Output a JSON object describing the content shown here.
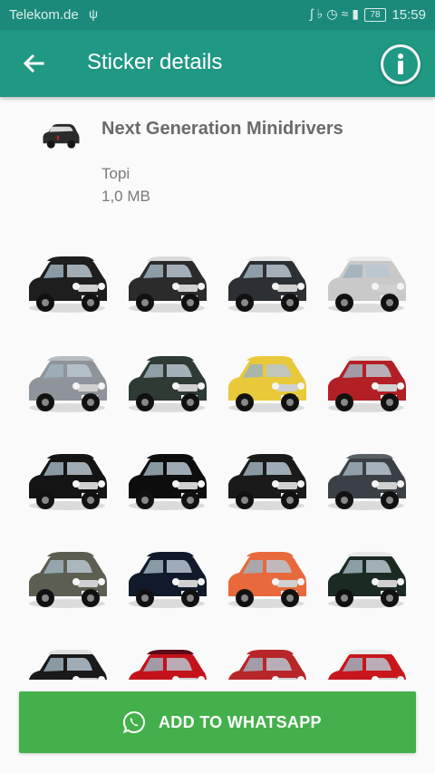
{
  "status_bar": {
    "carrier": "Telekom.de",
    "usb_icon": "usb-icon",
    "status_icons": "bluetooth, mute, alarm, wifi, signal",
    "battery": "78",
    "time": "15:59"
  },
  "app_bar": {
    "title": "Sticker details",
    "back_icon": "arrow-left-icon",
    "info_icon": "info-icon"
  },
  "pack": {
    "name": "Next Generation Minidrivers",
    "publisher": "Topi",
    "size": "1,0 MB"
  },
  "stickers": [
    {
      "body": "#1e1e1e",
      "roof": "#1e1e1e"
    },
    {
      "body": "#2b2b2b",
      "roof": "#d9d9d9"
    },
    {
      "body": "#2c2f33",
      "roof": "#e8e8e8"
    },
    {
      "body": "#c9c9c9",
      "roof": "#ececec"
    },
    {
      "body": "#8e949a",
      "roof": "#b7bcc1"
    },
    {
      "body": "#2e3a34",
      "roof": "#2e3a34"
    },
    {
      "body": "#e8c93a",
      "roof": "#e8c93a"
    },
    {
      "body": "#b22026",
      "roof": "#e8e8e8"
    },
    {
      "body": "#141414",
      "roof": "#141414"
    },
    {
      "body": "#0d0d0d",
      "roof": "#0d0d0d"
    },
    {
      "body": "#1a1a1a",
      "roof": "#1a1a1a"
    },
    {
      "body": "#3b4047",
      "roof": "#5a5f66"
    },
    {
      "body": "#5d5e52",
      "roof": "#5d5e52"
    },
    {
      "body": "#111a2a",
      "roof": "#111a2a"
    },
    {
      "body": "#e8693c",
      "roof": "#e8693c"
    },
    {
      "body": "#1b2a22",
      "roof": "#e8e8e8"
    },
    {
      "body": "#1a1a1a",
      "roof": "#e0e0e0"
    },
    {
      "body": "#c4121a",
      "roof": "#5a0b1a"
    },
    {
      "body": "#b8262a",
      "roof": "#b8262a"
    },
    {
      "body": "#c8161c",
      "roof": "#e8e8e8"
    }
  ],
  "button": {
    "label": "ADD TO WHATSAPP",
    "icon": "whatsapp-icon"
  },
  "colors": {
    "app_bar": "#1f9884",
    "status_bar": "#1c8a7a",
    "button": "#44b04b"
  }
}
